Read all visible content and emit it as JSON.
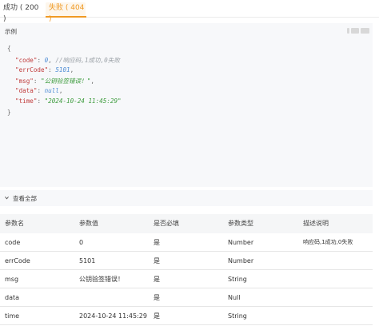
{
  "tabs": {
    "success": "成功 ( 200 )",
    "fail": "失败 ( 404 )"
  },
  "example": {
    "label": "示例",
    "copy_icon": "copy-icon"
  },
  "code": {
    "open": "{",
    "close": "}",
    "lines": [
      {
        "key": "\"code\"",
        "value": "0",
        "comment": "//响应码,1成功,0失败"
      },
      {
        "key": "\"errCode\"",
        "value": "5101"
      },
      {
        "key": "\"msg\"",
        "value": "\"公钥验签错误！\""
      },
      {
        "key": "\"data\"",
        "value": "null"
      },
      {
        "key": "\"time\"",
        "value": "\"2024-10-24 11:45:29\""
      }
    ]
  },
  "expand": {
    "label": "查看全部",
    "icon": "chevron-down-icon"
  },
  "table": {
    "headers": [
      "参数名",
      "参数值",
      "是否必填",
      "参数类型",
      "描述说明"
    ],
    "rows": [
      [
        "code",
        "0",
        "是",
        "Number",
        "响应码,1成功,0失败"
      ],
      [
        "errCode",
        "5101",
        "是",
        "Number",
        ""
      ],
      [
        "msg",
        "公钥验签错误！",
        "是",
        "String",
        ""
      ],
      [
        "data",
        "",
        "是",
        "Null",
        ""
      ],
      [
        "time",
        "2024-10-24 11:45:29",
        "是",
        "String",
        ""
      ]
    ]
  },
  "colors": {
    "accent": "#f09a24",
    "panel": "#f7f8fa",
    "json_key": "#c03b3b",
    "json_number": "#4a8ad4",
    "json_string": "#3a9a3a"
  }
}
